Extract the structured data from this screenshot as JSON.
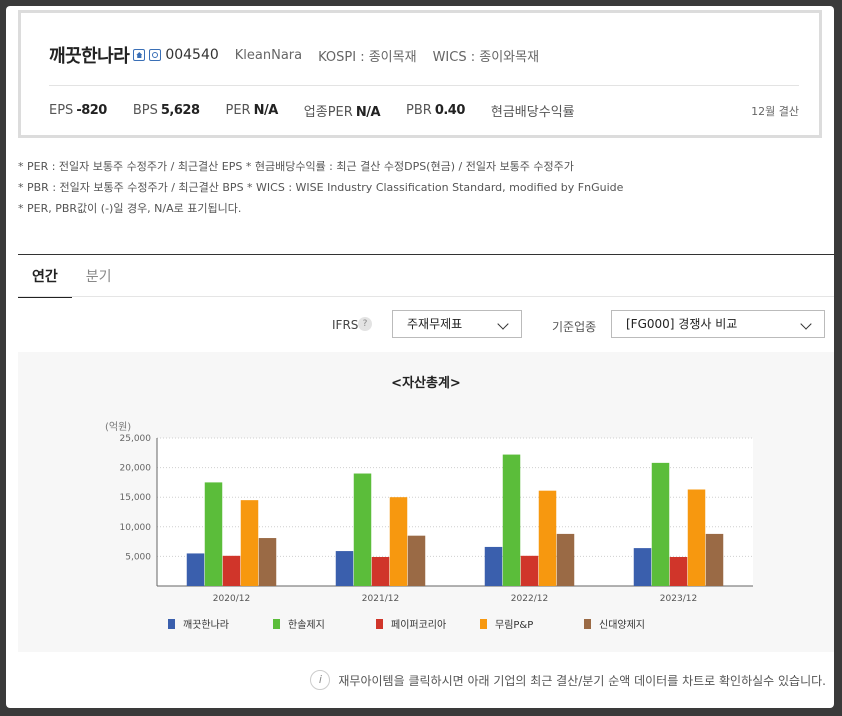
{
  "header": {
    "company_name": "깨끗한나라",
    "stock_code": "004540",
    "english_name": "KleanNara",
    "market": "KOSPI : 종이목재",
    "wics": "WICS : 종이와목재",
    "metrics": [
      {
        "label": "EPS",
        "value": "-820"
      },
      {
        "label": "BPS",
        "value": "5,628"
      },
      {
        "label": "PER",
        "value": "N/A"
      },
      {
        "label": "업종PER",
        "value": "N/A"
      },
      {
        "label": "PBR",
        "value": "0.40"
      },
      {
        "label": "현금배당수익률",
        "value": ""
      }
    ],
    "settlement": "12월 결산"
  },
  "notes": [
    "* PER : 전일자 보통주 수정주가 / 최근결산 EPS * 현금배당수익률 : 최근 결산 수정DPS(현금) / 전일자 보통주 수정주가",
    "* PBR : 전일자 보통주 수정주가 / 최근결산 BPS * WICS : WISE Industry Classification Standard, modified by FnGuide",
    "* PER, PBR값이 (-)일 경우, N/A로 표기됩니다."
  ],
  "tabs": [
    {
      "label": "연간",
      "active": true
    },
    {
      "label": "분기",
      "active": false
    }
  ],
  "controls": {
    "ifrs_label": "IFRS",
    "help_icon": "?",
    "statement_select": "주재무제표",
    "industry_label": "기준업종",
    "industry_select": "[FG000] 경쟁사 비교"
  },
  "chart_data": {
    "type": "bar",
    "title": "<자산총계>",
    "ylabel": "(억원)",
    "ylim": [
      0,
      25000
    ],
    "yticks": [
      5000,
      10000,
      15000,
      20000,
      25000
    ],
    "ytick_labels": [
      "5,000",
      "10,000",
      "15,000",
      "20,000",
      "25,000"
    ],
    "categories": [
      "2020/12",
      "2021/12",
      "2022/12",
      "2023/12"
    ],
    "series": [
      {
        "name": "깨끗한나라",
        "color": "#3a5fad",
        "values": [
          5500,
          5900,
          6600,
          6400
        ]
      },
      {
        "name": "한솔제지",
        "color": "#5bbd3a",
        "values": [
          17500,
          19000,
          22200,
          20800
        ]
      },
      {
        "name": "페이퍼코리아",
        "color": "#d0352a",
        "values": [
          5100,
          4900,
          5100,
          4900
        ]
      },
      {
        "name": "무림P&P",
        "color": "#f7980f",
        "values": [
          14500,
          15000,
          16100,
          16300
        ]
      },
      {
        "name": "신대양제지",
        "color": "#9a6a45",
        "values": [
          8100,
          8500,
          8800,
          8800
        ]
      }
    ],
    "grid": true,
    "legend_position": "bottom"
  },
  "footnote": {
    "icon": "i",
    "text": "재무아이템을 클릭하시면 아래 기업의 최근 결산/분기 순액 데이터를 차트로 확인하실수 있습니다."
  }
}
